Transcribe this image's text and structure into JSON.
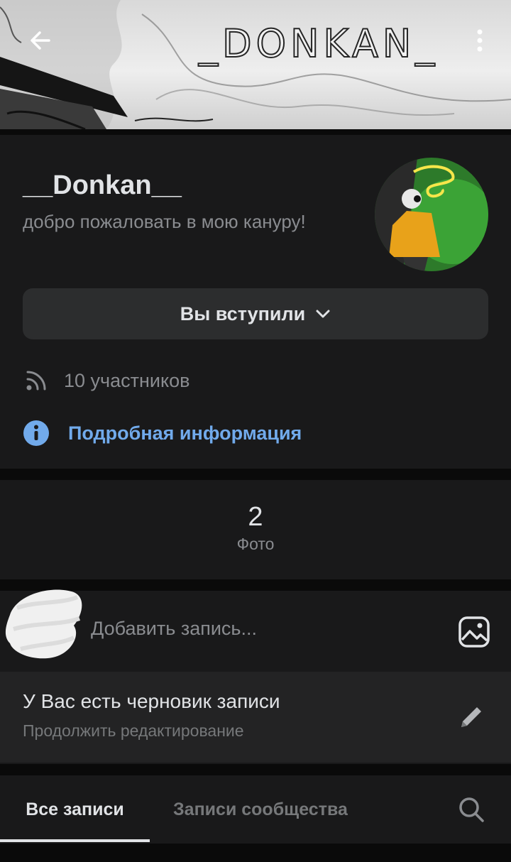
{
  "cover": {
    "title": "_DONKAN_",
    "back_icon": "arrow-left-icon",
    "more_icon": "more-vertical-icon"
  },
  "group": {
    "name": "__Donkan__",
    "status": "добро пожаловать в мою кануру!",
    "join_button_label": "Вы вступили",
    "members_text": "10 участников",
    "info_link": "Подробная информация"
  },
  "counters": {
    "photos_count": "2",
    "photos_label": "Фото"
  },
  "composer": {
    "placeholder": "Добавить запись...",
    "draft_title": "У Вас есть черновик записи",
    "draft_subtitle": "Продолжить редактирование"
  },
  "tabs": {
    "all": "Все записи",
    "community": "Записи сообщества"
  },
  "colors": {
    "background": "#0a0a0a",
    "card": "#19191a",
    "button": "#2c2d2e",
    "accent_link": "#71aaeb",
    "text_primary": "#e1e3e6",
    "text_secondary": "#8a8c90"
  }
}
